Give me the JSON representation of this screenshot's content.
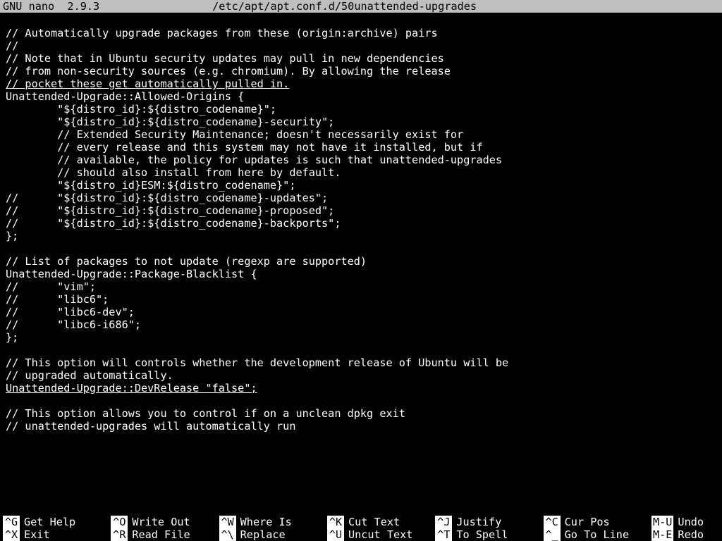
{
  "header": {
    "app": "GNU nano  2.9.3",
    "file": "/etc/apt/apt.conf.d/50unattended-upgrades"
  },
  "content_lines": [
    "",
    "// Automatically upgrade packages from these (origin:archive) pairs",
    "//",
    "// Note that in Ubuntu security updates may pull in new dependencies",
    "// from non-security sources (e.g. chromium). By allowing the release",
    "// pocket these get automatically pulled in.",
    "Unattended-Upgrade::Allowed-Origins {",
    "        \"${distro_id}:${distro_codename}\";",
    "        \"${distro_id}:${distro_codename}-security\";",
    "        // Extended Security Maintenance; doesn't necessarily exist for",
    "        // every release and this system may not have it installed, but if",
    "        // available, the policy for updates is such that unattended-upgrades",
    "        // should also install from here by default.",
    "        \"${distro_id}ESM:${distro_codename}\";",
    "//      \"${distro_id}:${distro_codename}-updates\";",
    "//      \"${distro_id}:${distro_codename}-proposed\";",
    "//      \"${distro_id}:${distro_codename}-backports\";",
    "};",
    "",
    "// List of packages to not update (regexp are supported)",
    "Unattended-Upgrade::Package-Blacklist {",
    "//      \"vim\";",
    "//      \"libc6\";",
    "//      \"libc6-dev\";",
    "//      \"libc6-i686\";",
    "};",
    "",
    "// This option will controls whether the development release of Ubuntu will be",
    "// upgraded automatically.",
    "Unattended-Upgrade::DevRelease \"false\";",
    "",
    "// This option allows you to control if on a unclean dpkg exit",
    "// unattended-upgrades will automatically run"
  ],
  "underlined_lines": [
    5,
    29
  ],
  "shortcuts": {
    "row1": [
      {
        "key": "^G",
        "label": "Get Help"
      },
      {
        "key": "^O",
        "label": "Write Out"
      },
      {
        "key": "^W",
        "label": "Where Is"
      },
      {
        "key": "^K",
        "label": "Cut Text"
      },
      {
        "key": "^J",
        "label": "Justify"
      },
      {
        "key": "^C",
        "label": "Cur Pos"
      }
    ],
    "row2": [
      {
        "key": "^X",
        "label": "Exit"
      },
      {
        "key": "^R",
        "label": "Read File"
      },
      {
        "key": "^\\",
        "label": "Replace"
      },
      {
        "key": "^U",
        "label": "Uncut Text"
      },
      {
        "key": "^T",
        "label": "To Spell"
      },
      {
        "key": "^_",
        "label": "Go To Line"
      }
    ],
    "extra": [
      {
        "key": "M-U",
        "label": "Undo"
      },
      {
        "key": "M-E",
        "label": "Redo"
      }
    ]
  }
}
